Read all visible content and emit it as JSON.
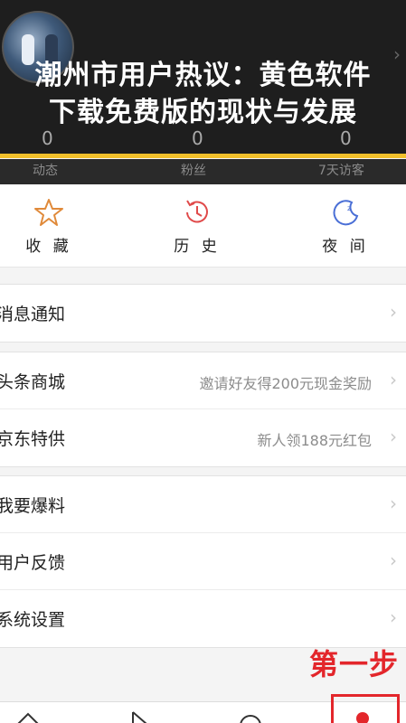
{
  "header": {
    "title_line1": "潮州市用户热议：黄色软件",
    "title_line2": "下载免费版的现状与发展",
    "stats": [
      {
        "value": "0",
        "label": "动态"
      },
      {
        "value": "0",
        "label": "粉丝"
      },
      {
        "value": "0",
        "label": "7天访客"
      }
    ],
    "accent_color": "#f2c02b"
  },
  "shortcuts": [
    {
      "label": "收 藏",
      "icon": "star-icon"
    },
    {
      "label": "历 史",
      "icon": "history-clock-icon"
    },
    {
      "label": "夜 间",
      "icon": "moon-icon"
    }
  ],
  "menu": {
    "notifications": {
      "label": "消息通知"
    },
    "mall": {
      "label": "头条商城",
      "hint": "邀请好友得200元现金奖励"
    },
    "jd": {
      "label": "京东特供",
      "hint": "新人领188元红包"
    },
    "report": {
      "label": "我要爆料"
    },
    "feedback": {
      "label": "用户反馈"
    },
    "settings": {
      "label": "系统设置"
    }
  },
  "annotation": {
    "step": "第一步",
    "color": "#e3262b"
  },
  "tabbar": {
    "icons": [
      "home-icon",
      "video-play-icon",
      "search-icon",
      "profile-icon"
    ]
  }
}
